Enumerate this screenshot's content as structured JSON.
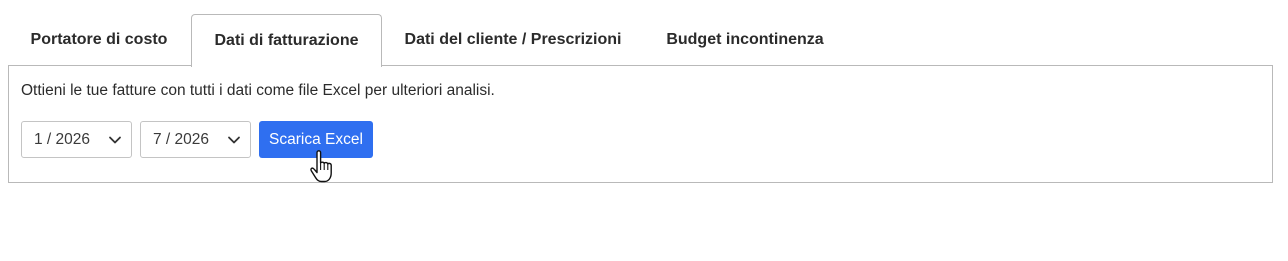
{
  "tabs": [
    {
      "label": "Portatore di costo",
      "active": false
    },
    {
      "label": "Dati di fatturazione",
      "active": true
    },
    {
      "label": "Dati del cliente / Prescrizioni",
      "active": false
    },
    {
      "label": "Budget incontinenza",
      "active": false
    }
  ],
  "panel": {
    "description": "Ottieni le tue fatture con tutti i dati come file Excel per ulteriori analisi.",
    "from_select": {
      "value": "1 / 2026",
      "icon": "chevron-down-icon"
    },
    "to_select": {
      "value": "7 / 2026",
      "icon": "chevron-down-icon"
    },
    "download_button": {
      "label": "Scarica Excel"
    }
  },
  "colors": {
    "accent": "#2f6ff0",
    "border": "#b9b9b9",
    "text": "#2b2b2b"
  },
  "cursor": {
    "icon": "hand-pointer-icon"
  }
}
